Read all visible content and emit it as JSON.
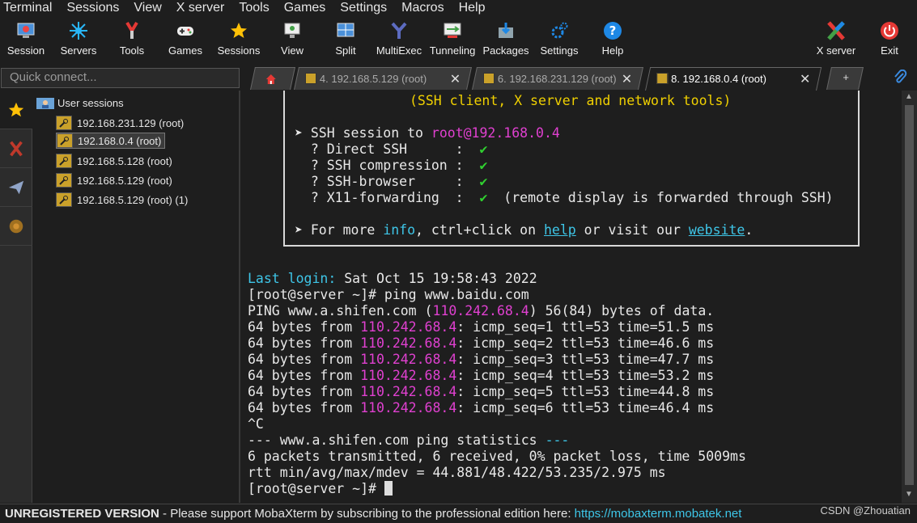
{
  "menu": [
    "Terminal",
    "Sessions",
    "View",
    "X server",
    "Tools",
    "Games",
    "Settings",
    "Macros",
    "Help"
  ],
  "toolbar": {
    "session": "Session",
    "servers": "Servers",
    "tools": "Tools",
    "games": "Games",
    "sessions": "Sessions",
    "view": "View",
    "split": "Split",
    "multiexec": "MultiExec",
    "tunneling": "Tunneling",
    "packages": "Packages",
    "settings": "Settings",
    "help": "Help",
    "xserver": "X server",
    "exit": "Exit"
  },
  "quick_connect": {
    "placeholder": "Quick connect..."
  },
  "tabs": [
    {
      "label": "4. 192.168.5.129 (root)"
    },
    {
      "label": "6. 192.168.231.129 (root)"
    },
    {
      "label": "8. 192.168.0.4 (root)"
    }
  ],
  "sessions": {
    "root": "User sessions",
    "items": [
      "192.168.231.129 (root)",
      "192.168.0.4 (root)",
      "192.168.5.128 (root)",
      "192.168.5.129 (root)",
      "192.168.5.129 (root) (1)"
    ]
  },
  "terminal": {
    "banner_title": "(SSH client, X server and network tools)",
    "ssh_prefix": "➤ SSH session to ",
    "ssh_target": "root@192.168.0.4",
    "features": [
      {
        "label": "  ? Direct SSH      :  ",
        "value": "✔",
        "note": ""
      },
      {
        "label": "  ? SSH compression :  ",
        "value": "✔",
        "note": ""
      },
      {
        "label": "  ? SSH-browser     :  ",
        "value": "✔",
        "note": ""
      },
      {
        "label": "  ? X11-forwarding  :  ",
        "value": "✔",
        "note": "  (remote display is forwarded through SSH)"
      }
    ],
    "more_prefix": "➤ For more ",
    "more_info": "info",
    "more_mid": ", ctrl+click on ",
    "more_help": "help",
    "more_mid2": " or visit our ",
    "more_website": "website",
    "more_end": ".",
    "last_login_label": "Last login:",
    "last_login_value": " Sat Oct 15 19:58:43 2022",
    "prompt1": "[root@server ~]# ping www.baidu.com",
    "ping_head_a": "PING www.a.shifen.com (",
    "ping_ip": "110.242.68.4",
    "ping_head_b": ") 56(84) bytes of data.",
    "replies": [
      {
        "pre": "64 bytes from ",
        "ip": "110.242.68.4",
        "post": ": icmp_seq=1 ttl=53 time=51.5 ms"
      },
      {
        "pre": "64 bytes from ",
        "ip": "110.242.68.4",
        "post": ": icmp_seq=2 ttl=53 time=46.6 ms"
      },
      {
        "pre": "64 bytes from ",
        "ip": "110.242.68.4",
        "post": ": icmp_seq=3 ttl=53 time=47.7 ms"
      },
      {
        "pre": "64 bytes from ",
        "ip": "110.242.68.4",
        "post": ": icmp_seq=4 ttl=53 time=53.2 ms"
      },
      {
        "pre": "64 bytes from ",
        "ip": "110.242.68.4",
        "post": ": icmp_seq=5 ttl=53 time=44.8 ms"
      },
      {
        "pre": "64 bytes from ",
        "ip": "110.242.68.4",
        "post": ": icmp_seq=6 ttl=53 time=46.4 ms"
      }
    ],
    "ctrlc": "^C",
    "stats_a": "--- www.a.shifen.com ping statistics ",
    "stats_b": "---",
    "stats_1": "6 packets transmitted, 6 received, 0% packet loss, time 5009ms",
    "stats_2": "rtt min/avg/max/mdev = 44.881/48.422/53.235/2.975 ms",
    "prompt2": "[root@server ~]# "
  },
  "status": {
    "unregistered": "UNREGISTERED VERSION",
    "message": "  -  Please support MobaXterm by subscribing to the professional edition here:  ",
    "link": "https://mobaxterm.mobatek.net",
    "watermark": "CSDN @Zhouatian"
  }
}
